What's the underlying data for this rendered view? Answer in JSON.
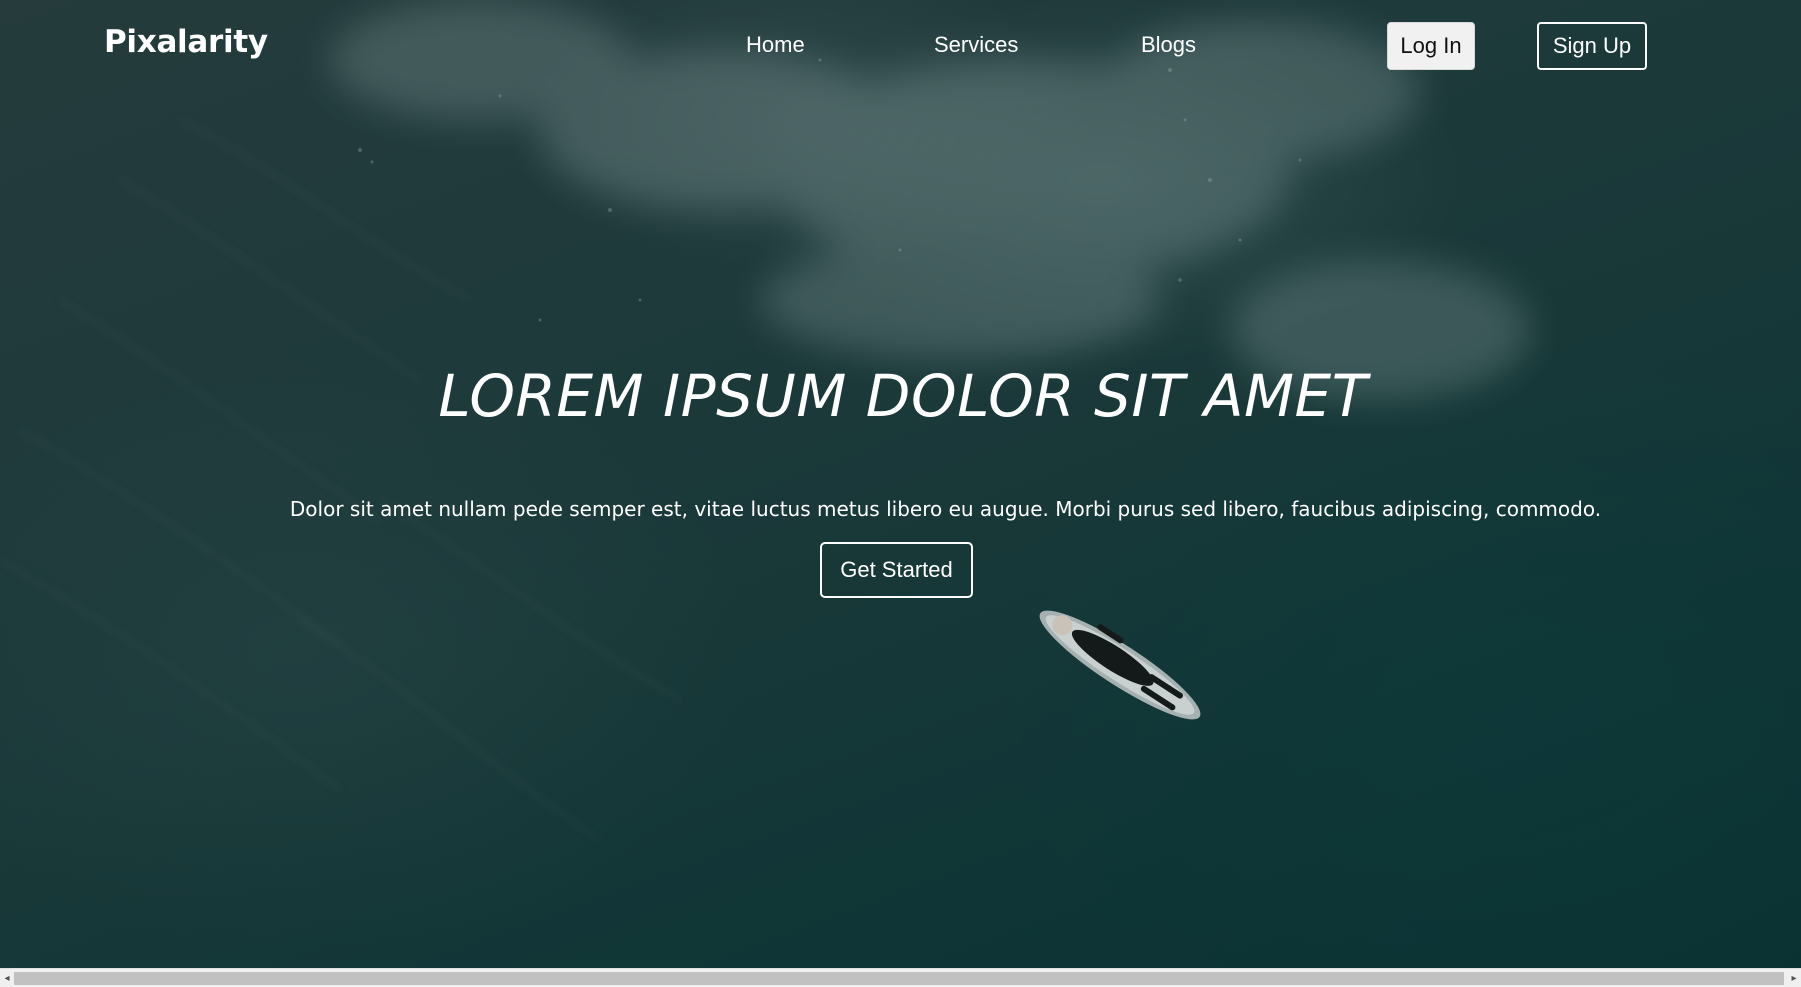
{
  "navbar": {
    "logo": "Pixalarity",
    "links": [
      "Home",
      "Services",
      "Blogs"
    ],
    "login_label": "Log In",
    "signup_label": "Sign Up"
  },
  "hero": {
    "title": "LOREM IPSUM DOLOR SIT AMET",
    "subtitle": "Dolor sit amet nullam pede semper est, vitae luctus metus libero eu augue. Morbi purus sed libero, faucibus adipiscing, commodo.",
    "cta_label": "Get Started",
    "background_description_icon": "ocean-surfer-photo"
  },
  "scrollbar": {
    "left_arrow_icon": "chevron-left-icon",
    "right_arrow_icon": "chevron-right-icon"
  },
  "colors": {
    "text": "#ffffff",
    "login_bg": "#f1f1f1",
    "ocean_dark": "#0f3536",
    "scrollbar_thumb": "#c1c1c1"
  }
}
